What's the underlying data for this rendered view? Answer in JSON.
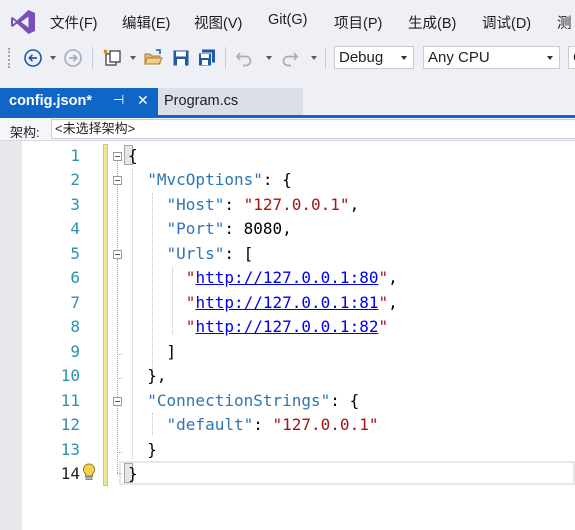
{
  "menu": [
    "文件(F)",
    "编辑(E)",
    "视图(V)",
    "Git(G)",
    "项目(P)",
    "生成(B)",
    "调试(D)",
    "测"
  ],
  "toolbar": {
    "icons": [
      "back-icon",
      "forward-icon",
      "new-project-icon",
      "open-folder-icon",
      "save-icon",
      "save-all-icon",
      "undo-icon",
      "redo-icon"
    ],
    "config": "Debug",
    "platform": "Any CPU",
    "partial": "C"
  },
  "tabs": [
    {
      "title": "config.json*",
      "active": true,
      "pin": "⊣",
      "close": "✕"
    },
    {
      "title": "Program.cs",
      "active": false
    }
  ],
  "navbar": {
    "label": "架构:",
    "value": "<未选择架构>"
  },
  "editor": {
    "line_numbers": [
      "1",
      "2",
      "3",
      "4",
      "5",
      "6",
      "7",
      "8",
      "9",
      "10",
      "11",
      "12",
      "13",
      "14"
    ],
    "tokens": {
      "l1": "{",
      "l2_key": "\"MvcOptions\"",
      "l2_rest": ": {",
      "l3_key": "\"Host\"",
      "l3_mid": ": ",
      "l3_val": "\"127.0.0.1\"",
      "l3_end": ",",
      "l4_key": "\"Port\"",
      "l4_rest": ": 8080,",
      "l5_key": "\"Urls\"",
      "l5_rest": ": [",
      "l6_q1": "\"",
      "l6_url": "http://127.0.0.1:80",
      "l6_q2": "\"",
      "l6_end": ",",
      "l7_q1": "\"",
      "l7_url": "http://127.0.0.1:81",
      "l7_q2": "\"",
      "l7_end": ",",
      "l8_q1": "\"",
      "l8_url": "http://127.0.0.1:82",
      "l8_q2": "\"",
      "l9": "]",
      "l10": "},",
      "l11_key": "\"ConnectionStrings\"",
      "l11_rest": ": {",
      "l12_key": "\"default\"",
      "l12_mid": ": ",
      "l12_val": "\"127.0.0.1\"",
      "l13": "}",
      "l14": "}"
    }
  },
  "colors": {
    "accent": "#1066c6",
    "key": "#2e75b6",
    "string": "#a31515",
    "link": "#0000ee",
    "line_number": "#2b91af"
  }
}
